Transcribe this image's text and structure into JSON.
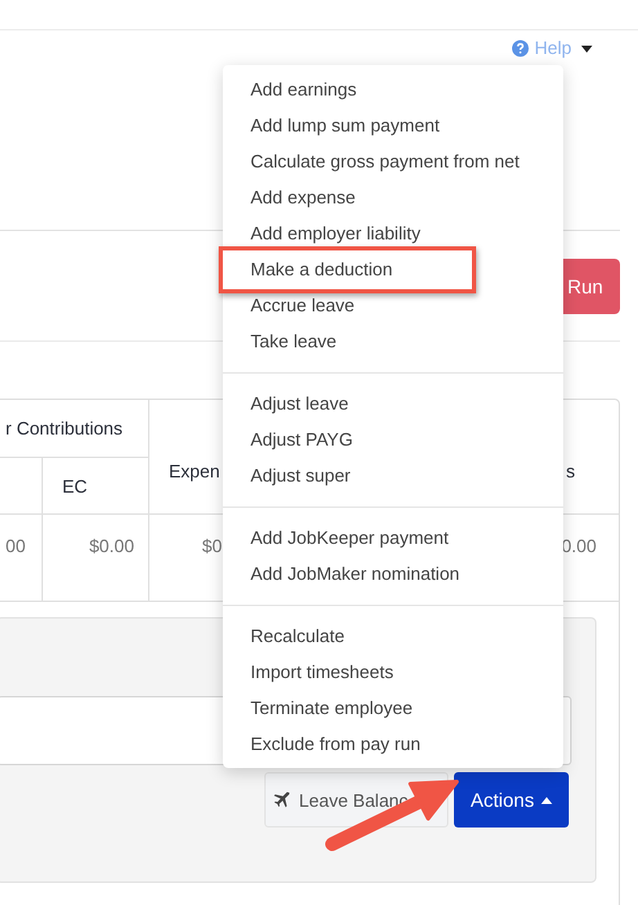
{
  "help_link": {
    "label": "Help"
  },
  "run_button": {
    "label": "Run"
  },
  "table": {
    "group_header": "r Contributions",
    "sub_headers": [
      "EC",
      "Expen",
      "s"
    ],
    "row": [
      "00",
      "$0.00",
      "$0",
      "0.00"
    ]
  },
  "panel": {
    "buttons": [
      {
        "kind": "leave",
        "label": "Leave Balanc"
      },
      {
        "kind": "actions",
        "label": "Actions",
        "expanded": true
      }
    ]
  },
  "actions_menu": {
    "groups": [
      [
        {
          "label": "Add earnings",
          "highlighted": false
        },
        {
          "label": "Add lump sum payment",
          "highlighted": false
        },
        {
          "label": "Calculate gross payment from net",
          "highlighted": false
        },
        {
          "label": "Add expense",
          "highlighted": false
        },
        {
          "label": "Add employer liability",
          "highlighted": false
        },
        {
          "label": "Make a deduction",
          "highlighted": true
        },
        {
          "label": "Accrue leave",
          "highlighted": false
        },
        {
          "label": "Take leave",
          "highlighted": false
        }
      ],
      [
        {
          "label": "Adjust leave",
          "highlighted": false
        },
        {
          "label": "Adjust PAYG",
          "highlighted": false
        },
        {
          "label": "Adjust super",
          "highlighted": false
        }
      ],
      [
        {
          "label": "Add JobKeeper payment",
          "highlighted": false
        },
        {
          "label": "Add JobMaker nomination",
          "highlighted": false
        }
      ],
      [
        {
          "label": "Recalculate",
          "highlighted": false
        },
        {
          "label": "Import timesheets",
          "highlighted": false
        },
        {
          "label": "Terminate employee",
          "highlighted": false
        },
        {
          "label": "Exclude from pay run",
          "highlighted": false
        }
      ]
    ]
  },
  "annotation": {
    "arrow": true
  }
}
